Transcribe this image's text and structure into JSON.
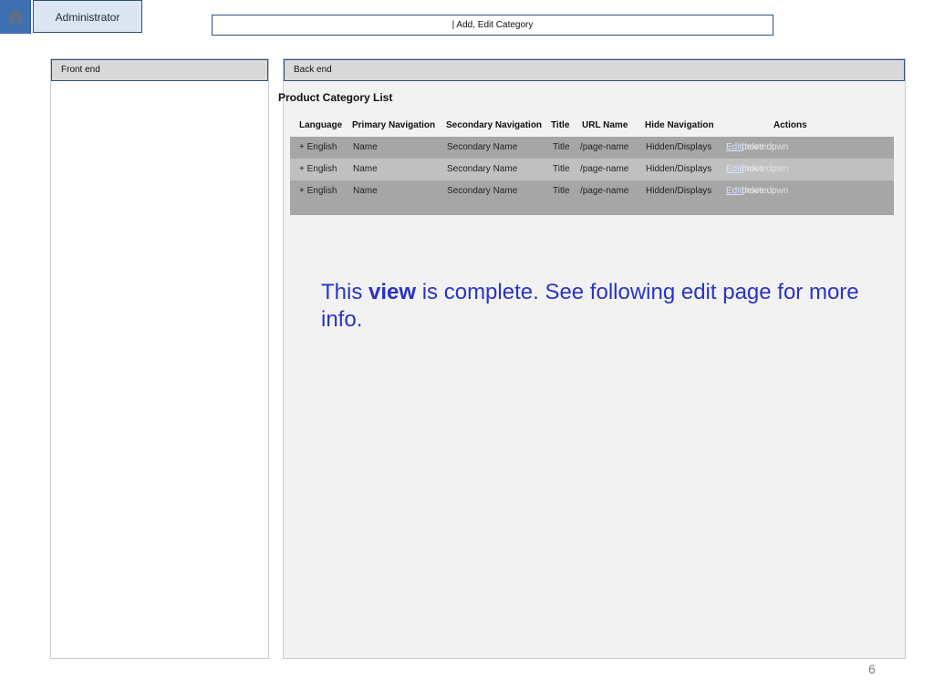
{
  "header": {
    "home_icon": "home-icon",
    "admin_label": "Administrator",
    "breadcrumb": "| Add, Edit Category"
  },
  "panels": {
    "front_end": "Front end",
    "back_end": "Back end"
  },
  "content": {
    "title": "Product Category List",
    "columns": [
      "Language",
      "Primary Navigation",
      "Secondary Navigation",
      "Title",
      "URL Name",
      "Hide Navigation",
      "Actions"
    ],
    "rows": [
      {
        "language": "+ English",
        "primary": "Name",
        "secondary": "Secondary Name",
        "title": "Title",
        "url": "/page-name",
        "hide": "Hidden/Displays",
        "actions": [
          "Edit",
          "delete",
          "move up",
          "move down"
        ]
      },
      {
        "language": "+ English",
        "primary": "Name",
        "secondary": "Secondary Name",
        "title": "Title",
        "url": "/page-name",
        "hide": "Hidden/Displays",
        "actions": [
          "Edit",
          "delete",
          "move up",
          "move down"
        ]
      },
      {
        "language": "+ English",
        "primary": "Name",
        "secondary": "Secondary Name",
        "title": "Title",
        "url": "/page-name",
        "hide": "Hidden/Displays",
        "actions": [
          "Edit",
          "delete",
          "move up",
          "move down"
        ]
      }
    ],
    "separator": "|"
  },
  "note": {
    "before": "This",
    "strong": "view",
    "after": "is complete. See following edit page for more info."
  },
  "footer": {
    "page_number": "6"
  },
  "colors": {
    "accent": "#3f6fb3",
    "admin_tab_bg": "#dce6f2",
    "note_text": "#2a33c9",
    "row_dark": "#a6a6a6",
    "row_light": "#c0c0c0"
  }
}
